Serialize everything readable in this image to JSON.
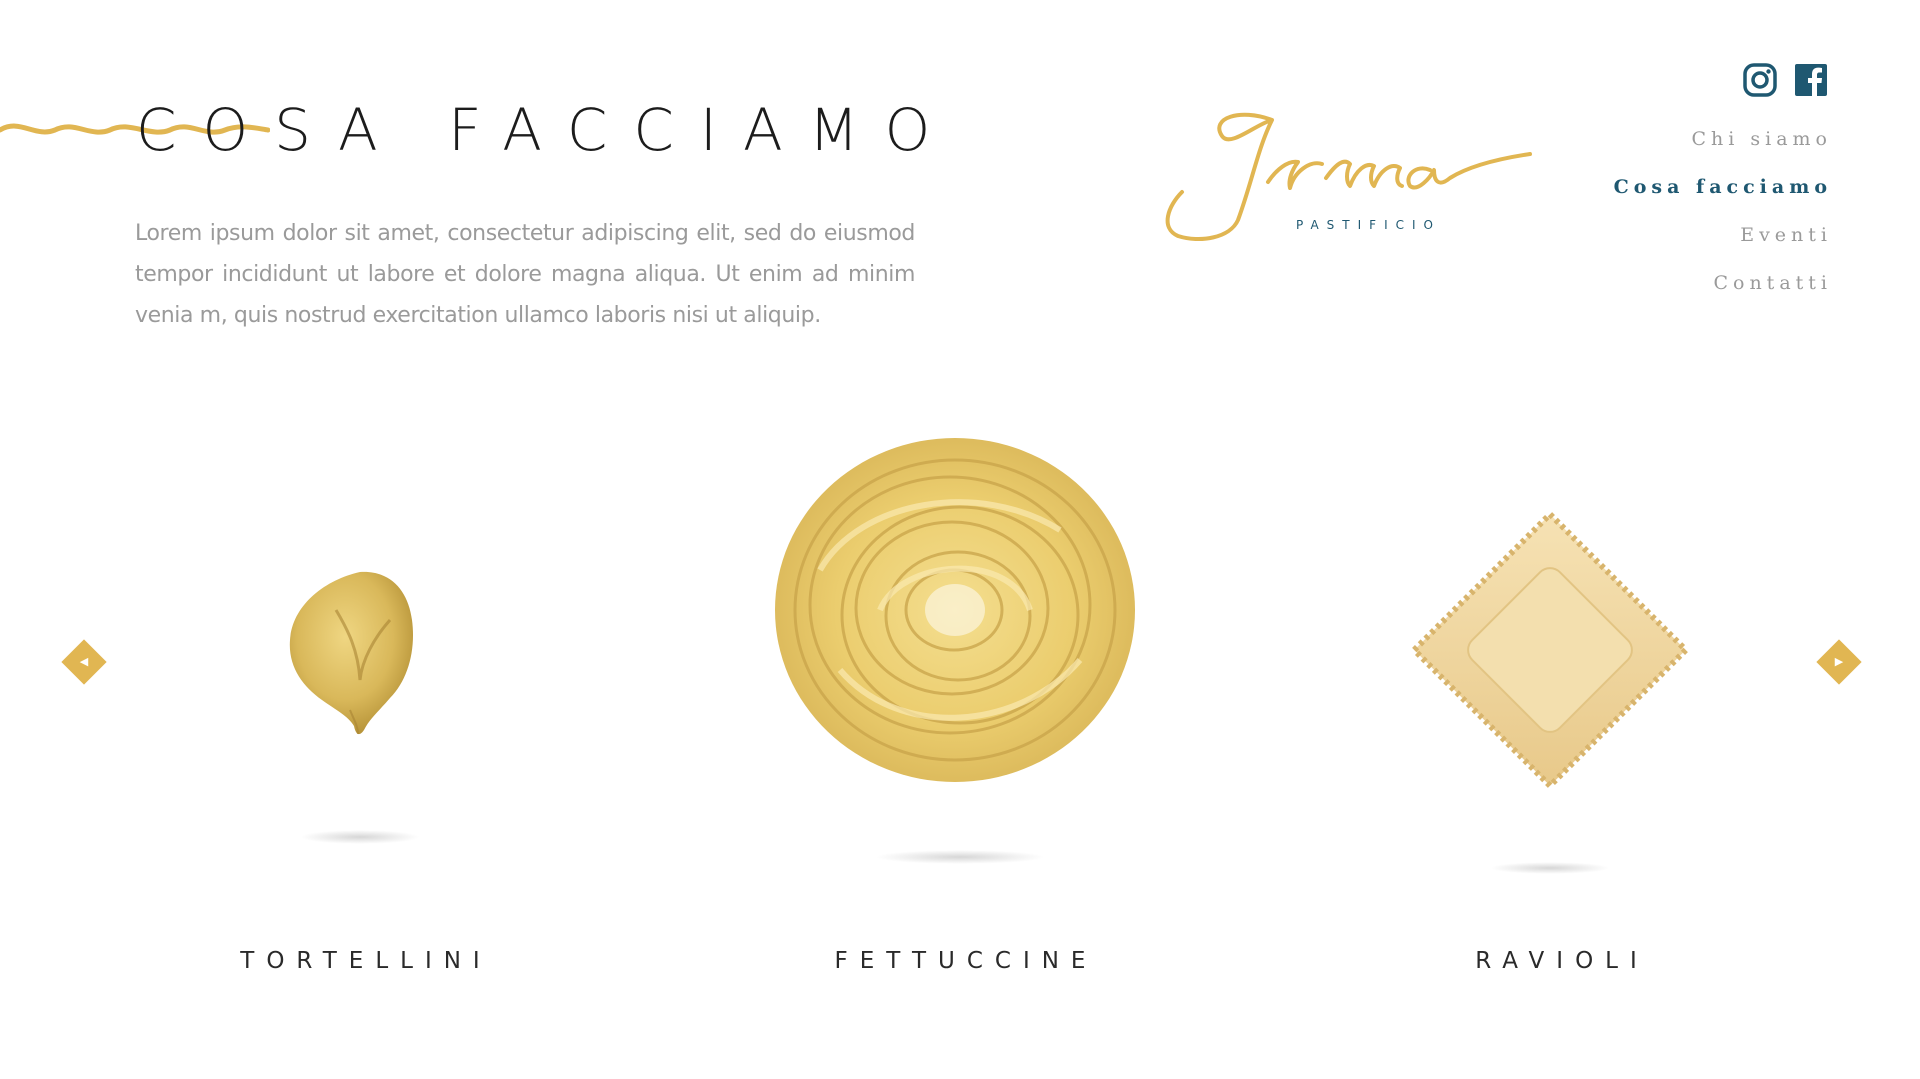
{
  "header": {
    "title": "COSA FACCIAMO",
    "intro": "Lorem ipsum dolor sit amet, consectetur adipiscing elit, sed do eiusmod tempor incididunt ut labore et dolore magna aliqua. Ut enim ad minim venia m, quis nostrud exercitation ullamco laboris nisi ut aliquip."
  },
  "brand": {
    "name": "Irma",
    "subtitle": "PASTIFICIO"
  },
  "social": [
    {
      "icon": "instagram-icon"
    },
    {
      "icon": "facebook-icon"
    }
  ],
  "nav": {
    "items": [
      {
        "label": "Chi siamo",
        "active": false
      },
      {
        "label": "Cosa facciamo",
        "active": true
      },
      {
        "label": "Eventi",
        "active": false
      },
      {
        "label": "Contatti",
        "active": false
      }
    ]
  },
  "carousel": {
    "prev_icon": "chevron-left-icon",
    "next_icon": "chevron-right-icon",
    "products": [
      {
        "label": "TORTELLINI",
        "image": "tortellini-image"
      },
      {
        "label": "FETTUCCINE",
        "image": "fettuccine-image"
      },
      {
        "label": "RAVIOLI",
        "image": "ravioli-image"
      }
    ]
  },
  "colors": {
    "accent": "#e1b652",
    "brand_blue": "#1f5871",
    "text_dark": "#1c1c1c",
    "text_muted": "#9a9a9a"
  }
}
